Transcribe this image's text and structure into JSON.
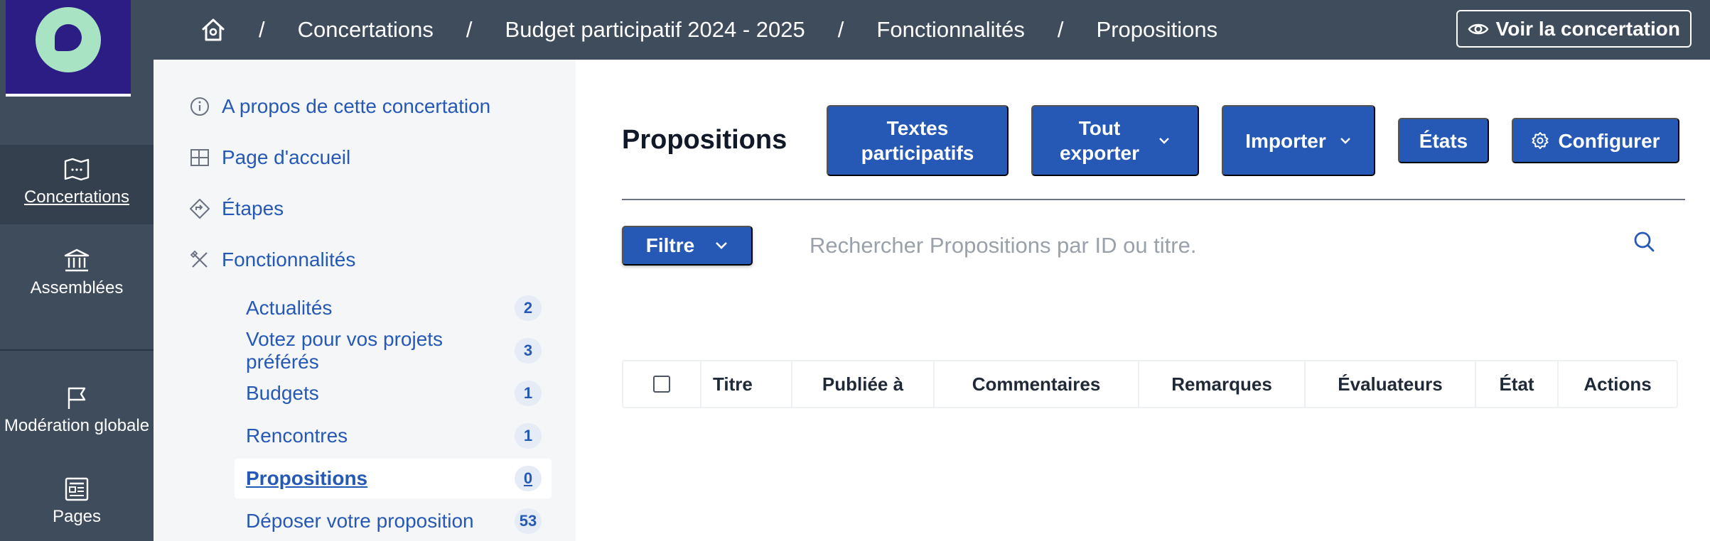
{
  "rail": {
    "items": [
      {
        "label": "Concertations",
        "icon": "map-icon"
      },
      {
        "label": "Assemblées",
        "icon": "institution-icon"
      },
      {
        "label": "Modération globale",
        "icon": "flag-icon"
      },
      {
        "label": "Pages",
        "icon": "page-icon"
      }
    ],
    "active_item": "Concertations",
    "logo_color": "#2c1d85",
    "logo_bubble_color": "#a8e4c4"
  },
  "breadcrumb": {
    "home_icon": "home-icon",
    "separator": "/",
    "items": [
      "Concertations",
      "Budget participatif 2024 - 2025",
      "Fonctionnalités",
      "Propositions"
    ]
  },
  "header": {
    "view_button": "Voir la concertation",
    "view_icon": "eye-icon"
  },
  "subnav": {
    "main_items": [
      {
        "label": "A propos de cette concertation",
        "icon": "info-icon"
      },
      {
        "label": "Page d'accueil",
        "icon": "layout-icon"
      },
      {
        "label": "Étapes",
        "icon": "steps-icon"
      },
      {
        "label": "Fonctionnalités",
        "icon": "tools-icon"
      }
    ],
    "components": [
      {
        "label": "Actualités",
        "count": "2"
      },
      {
        "label": "Votez pour vos projets préférés",
        "count": "3"
      },
      {
        "label": "Budgets",
        "count": "1"
      },
      {
        "label": "Rencontres",
        "count": "1"
      },
      {
        "label": "Propositions",
        "count": "0"
      },
      {
        "label": "Déposer votre proposition",
        "count": "53"
      }
    ],
    "active_component": "Propositions"
  },
  "main": {
    "title": "Propositions",
    "toolbar": {
      "textes_line1": "Textes",
      "textes_line2": "participatifs",
      "exporter_line1": "Tout",
      "exporter_line2": "exporter",
      "importer": "Importer",
      "etats": "États",
      "configurer": "Configurer"
    },
    "filter_label": "Filtre",
    "search_placeholder": "Rechercher Propositions par ID ou titre.",
    "table_headers": [
      "Titre",
      "Publiée à",
      "Commentaires",
      "Remarques",
      "Évaluateurs",
      "État",
      "Actions"
    ]
  },
  "colors": {
    "accent": "#2559b5",
    "topbar": "#3e4c5c",
    "subnav_bg": "#f4f6f8"
  }
}
